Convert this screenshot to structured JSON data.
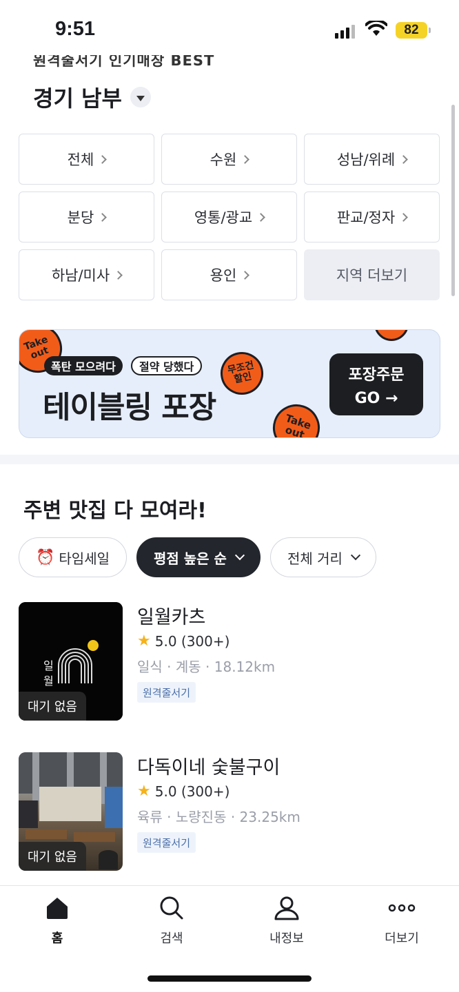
{
  "status_bar": {
    "time": "9:51",
    "battery": "82"
  },
  "top": {
    "cut_title": "원격줄서기 인기매장 BEST",
    "region_title": "경기 남부"
  },
  "regions": [
    {
      "label": "전체"
    },
    {
      "label": "수원"
    },
    {
      "label": "성남/위례"
    },
    {
      "label": "분당"
    },
    {
      "label": "영통/광교"
    },
    {
      "label": "판교/정자"
    },
    {
      "label": "하남/미사"
    },
    {
      "label": "용인"
    }
  ],
  "region_more_label": "지역 더보기",
  "banner": {
    "badge_dark": "폭탄 모으려다",
    "badge_light": "절약 당했다",
    "title": "테이블링 포장",
    "stamp_takeout": "Take out",
    "stamp_discount": "무조건 할인",
    "button_line1": "포장주문",
    "button_line2": "GO →"
  },
  "section": {
    "title": "주변 맛집 다 모여라!"
  },
  "filters": {
    "time_sale": "타임세일",
    "time_sale_icon": "alarm-clock-icon",
    "sort": "평점 높은 순",
    "distance": "전체 거리"
  },
  "stores": [
    {
      "name": "일월카츠",
      "rating": "5.0",
      "reviews": "(300+)",
      "meta": "일식 · 계동 · 18.12km",
      "tag": "원격줄서기",
      "wait": "대기 없음",
      "logo_text": "일\n월"
    },
    {
      "name": "다독이네 숯불구이",
      "rating": "5.0",
      "reviews": "(300+)",
      "meta": "육류 · 노량진동 · 23.25km",
      "tag": "원격줄서기",
      "wait": "대기 없음"
    }
  ],
  "tabbar": [
    {
      "label": "홈",
      "icon": "home-icon"
    },
    {
      "label": "검색",
      "icon": "search-icon"
    },
    {
      "label": "내정보",
      "icon": "person-icon"
    },
    {
      "label": "더보기",
      "icon": "more-dots-icon"
    }
  ],
  "colors": {
    "accent_orange": "#f25c19",
    "banner_bg": "#e6eefb",
    "dark": "#1d1e22",
    "star": "#f5b21b",
    "tag_text": "#4a6fa8"
  }
}
